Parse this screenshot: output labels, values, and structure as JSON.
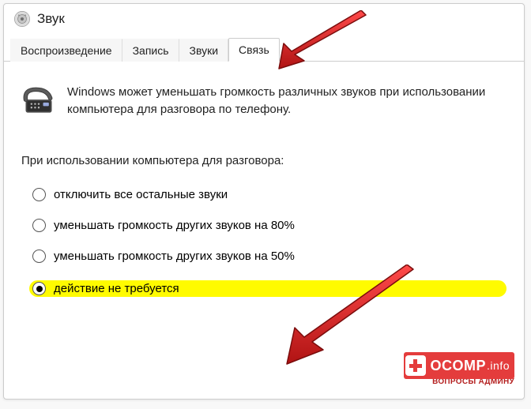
{
  "window": {
    "title": "Звук"
  },
  "tabs": {
    "t0": "Воспроизведение",
    "t1": "Запись",
    "t2": "Звуки",
    "t3": "Связь",
    "active": 3
  },
  "content": {
    "description": "Windows может уменьшать громкость различных звуков при использовании компьютера для разговора по телефону.",
    "question": "При использовании компьютера для разговора:",
    "options": {
      "o0": "отключить все остальные звуки",
      "o1": "уменьшать громкость других звуков на 80%",
      "o2": "уменьшать громкость других звуков на 50%",
      "o3": "действие не требуется"
    },
    "selected": 3
  },
  "watermark": {
    "brand": "OCOMP",
    "suffix": ".info",
    "sub": "ВОПРОСЫ АДМИНУ"
  }
}
